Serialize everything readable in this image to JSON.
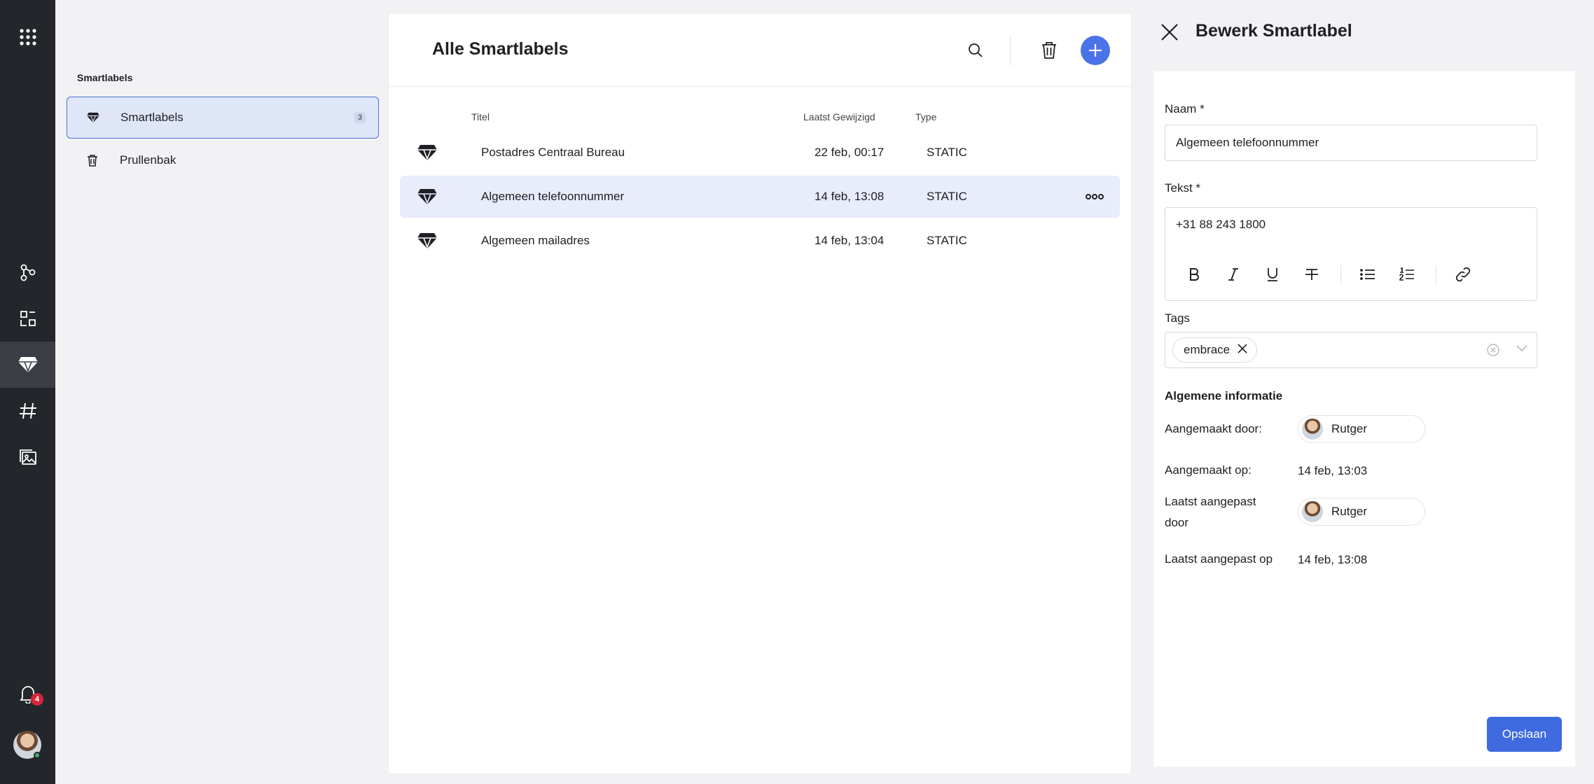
{
  "rail": {
    "icons": [
      "apps-grid-icon",
      "workflow-icon",
      "components-icon",
      "smartlabel-icon",
      "hashtag-icon",
      "media-folder-icon",
      "bell-icon"
    ],
    "notification_count": "4"
  },
  "sidebar": {
    "heading": "Smartlabels",
    "items": [
      {
        "label": "Smartlabels",
        "count": "3",
        "icon": "smartlabel-icon",
        "selected": true
      },
      {
        "label": "Prullenbak",
        "icon": "trash-icon",
        "selected": false
      }
    ]
  },
  "main": {
    "title": "Alle Smartlabels",
    "columns": [
      "Titel",
      "Laatst Gewijzigd",
      "Type"
    ],
    "rows": [
      {
        "title": "Postadres Centraal Bureau",
        "modified": "22 feb, 00:17",
        "type": "STATIC"
      },
      {
        "title": "Algemeen telefoonnummer",
        "modified": "14 feb, 13:08",
        "type": "STATIC",
        "selected": true
      },
      {
        "title": "Algemeen mailadres",
        "modified": "14 feb, 13:04",
        "type": "STATIC"
      }
    ]
  },
  "edit": {
    "title": "Bewerk Smartlabel",
    "name_label": "Naam *",
    "name_value": "Algemeen telefoonnummer",
    "text_label": "Tekst *",
    "text_value": "+31 88 243 1800",
    "tags_label": "Tags",
    "tags": [
      "embrace"
    ],
    "info_title": "Algemene informatie",
    "created_by_label": "Aangemaakt door:",
    "created_by": "Rutger",
    "created_on_label": "Aangemaakt op:",
    "created_on": "14 feb, 13:03",
    "modified_by_label": "Laatst aangepast door",
    "modified_by": "Rutger",
    "modified_on_label": "Laatst aangepast op",
    "modified_on": "14 feb, 13:08",
    "save_label": "Opslaan"
  },
  "colors": {
    "accent": "#4a73e8",
    "rail": "#23262b",
    "selected_row": "#e8ecfb",
    "badge": "#d6253a"
  }
}
